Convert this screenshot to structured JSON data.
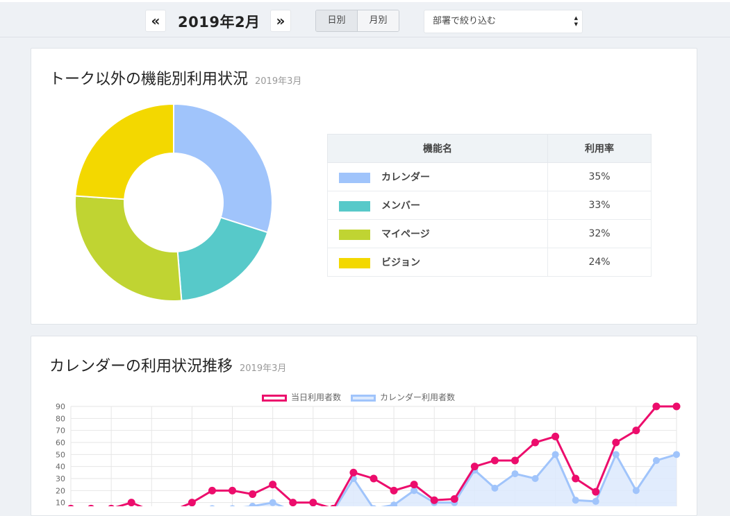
{
  "nav": {
    "prev_icon": "«",
    "next_icon": "»",
    "month_label": "2019年2月",
    "view_tabs": [
      {
        "label": "日別",
        "active": true
      },
      {
        "label": "月別",
        "active": false
      }
    ],
    "department_filter": {
      "selected": "部署で絞り込む"
    }
  },
  "feature_usage": {
    "title": "トーク以外の機能別利用状況",
    "subtitle": "2019年3月",
    "table_headers": {
      "name": "機能名",
      "rate": "利用率"
    },
    "rows": [
      {
        "name": "カレンダー",
        "rate": "35%",
        "color": "#a0c4fb"
      },
      {
        "name": "メンバー",
        "rate": "33%",
        "color": "#57c9c9"
      },
      {
        "name": "マイページ",
        "rate": "32%",
        "color": "#c0d432"
      },
      {
        "name": "ビジョン",
        "rate": "24%",
        "color": "#f3d800"
      }
    ]
  },
  "calendar_trend": {
    "title": "カレンダーの利用状況推移",
    "subtitle": "2019年3月",
    "legend": [
      {
        "label": "当日利用者数",
        "color": "#ec0d6c"
      },
      {
        "label": "カレンダー利用者数",
        "color": "#a0c4fb"
      }
    ]
  },
  "chart_data": [
    {
      "type": "pie",
      "labels": [
        "カレンダー",
        "メンバー",
        "マイページ",
        "ビジョン"
      ],
      "values": [
        35,
        22,
        32,
        28
      ],
      "colors": [
        "#a0c4fb",
        "#57c9c9",
        "#c0d432",
        "#f3d800"
      ],
      "donut": true
    },
    {
      "type": "line",
      "ylim": [
        0,
        90
      ],
      "yticks": [
        10,
        20,
        30,
        40,
        50,
        60,
        70,
        80,
        90
      ],
      "grid": true,
      "legend_position": "top-center",
      "series": [
        {
          "name": "当日利用者数",
          "color": "#ec0d6c",
          "values": [
            5,
            5,
            5,
            10,
            3,
            3,
            10,
            20,
            20,
            17,
            25,
            10,
            10,
            5,
            35,
            30,
            20,
            25,
            12,
            13,
            40,
            45,
            45,
            60,
            65,
            30,
            19,
            60,
            70,
            90,
            90
          ]
        },
        {
          "name": "カレンダー利用者数",
          "color": "#a0c4fb",
          "fill": true,
          "values": [
            0,
            0,
            0,
            0,
            0,
            0,
            5,
            5,
            5,
            7,
            10,
            3,
            5,
            3,
            30,
            5,
            8,
            20,
            10,
            10,
            37,
            22,
            34,
            30,
            50,
            12,
            11,
            50,
            20,
            45,
            50
          ]
        }
      ]
    }
  ]
}
